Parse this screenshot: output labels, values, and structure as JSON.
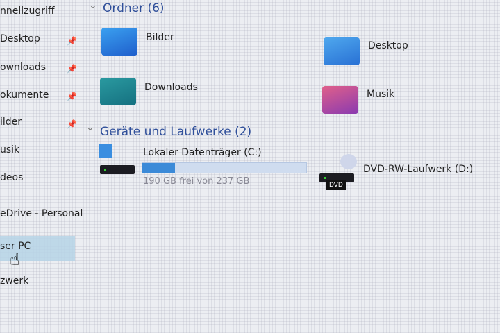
{
  "sidebar": {
    "items": [
      {
        "label": "nnellzugriff",
        "pinned": false
      },
      {
        "label": "Desktop",
        "pinned": true
      },
      {
        "label": "ownloads",
        "pinned": true
      },
      {
        "label": "okumente",
        "pinned": true
      },
      {
        "label": "ilder",
        "pinned": true
      },
      {
        "label": "usik",
        "pinned": false
      },
      {
        "label": "deos",
        "pinned": false
      },
      {
        "label": "eDrive - Personal",
        "pinned": false
      },
      {
        "label": "ser PC",
        "selected": true
      },
      {
        "label": "zwerk",
        "pinned": false
      }
    ],
    "pin_icon": "📌"
  },
  "sections": {
    "folders": {
      "title": "Ordner (6)",
      "items": [
        "Bilder",
        "Desktop",
        "Downloads",
        "Musik"
      ]
    },
    "drives": {
      "title": "Geräte und Laufwerke (2)",
      "c": {
        "name": "Lokaler Datenträger (C:)",
        "free": "190 GB frei von 237 GB",
        "used_fraction": 0.2
      },
      "d": {
        "name": "DVD-RW-Laufwerk (D:)",
        "badge": "DVD"
      }
    }
  },
  "chevron": "⌄",
  "cursor": "☝"
}
